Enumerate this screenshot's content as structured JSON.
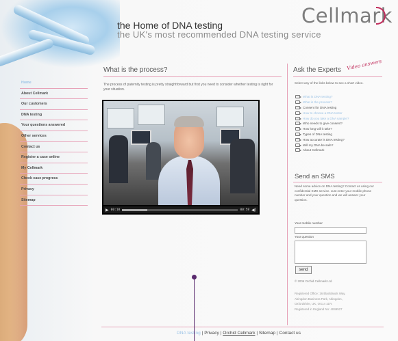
{
  "header": {
    "logo": "Cellmark",
    "title": "the Home of DNA testing",
    "subtitle": "the UK's most recommended DNA testing service"
  },
  "nav": {
    "items": [
      {
        "label": "Home",
        "active": true
      },
      {
        "label": "About Cellmark",
        "active": false
      },
      {
        "label": "Our customers",
        "active": false
      },
      {
        "label": "DNA testing",
        "active": false
      },
      {
        "label": "Your questions answered",
        "active": false
      },
      {
        "label": "Other services",
        "active": false
      },
      {
        "label": "Contact us",
        "active": false
      },
      {
        "label": "Register a case online",
        "active": false
      },
      {
        "label": "My Cellmark",
        "active": false
      },
      {
        "label": "Check case progress",
        "active": false
      },
      {
        "label": "Privacy",
        "active": false
      },
      {
        "label": "Sitemap",
        "active": false
      }
    ]
  },
  "main": {
    "heading": "What is the process?",
    "intro": "The process of paternity testing is pretty straightforward but first you need to consider whether testing is right for your situation.",
    "video": {
      "time_elapsed": "00:10",
      "time_total": "00:58",
      "progress": 0.22
    }
  },
  "experts": {
    "heading": "Ask the Experts",
    "badge": "Video answers",
    "intro": "Select any of the links below to see a short video.",
    "questions": [
      {
        "label": "What is DNA testing?",
        "visited": true
      },
      {
        "label": "What is the process?",
        "visited": true
      },
      {
        "label": "Consent for DNA testing",
        "visited": false
      },
      {
        "label": "How to choose a DNA tester",
        "visited": true
      },
      {
        "label": "How do you take a DNA sample?",
        "visited": true
      },
      {
        "label": "Who needs to give consent?",
        "visited": false
      },
      {
        "label": "How long will it take?",
        "visited": false
      },
      {
        "label": "Types of DNA testing",
        "visited": false
      },
      {
        "label": "How accurate is DNA testing?",
        "visited": false
      },
      {
        "label": "Will my DNA be safe?",
        "visited": false
      },
      {
        "label": "About Cellmark",
        "visited": false
      }
    ]
  },
  "sms": {
    "heading": "Send an SMS",
    "text": "Need some advice on DNA testing? Contact us using our confidential SMS service. Just enter your mobile phone number and your question and we will answer your question.",
    "mobile_label": "Your mobile number",
    "question_label": "Your question",
    "mobile_value": "",
    "question_value": "",
    "send_label": "send"
  },
  "legal": {
    "copyright": "© 2006 Orchid Cellmark Ltd.",
    "registered_lines": [
      "Registered Office: 16 Blacklands Way,",
      "Abingdon Business Park, Abingdon,",
      "Oxfordshire, UK, OX14 1DY.",
      "Registered in England No: 4049527"
    ]
  },
  "footer": {
    "link1": "DNA testing",
    "sep": " | ",
    "link2": "Privacy",
    "link3": "Orchid Cellmark",
    "link4": "Sitemap",
    "link5": "Contact us"
  },
  "colors": {
    "accent_pink": "#e7a2b8",
    "brand_magenta": "#c12d5c",
    "visited_blue": "#9cc3e6",
    "callout_purple": "#5a2a6e"
  },
  "icons": {
    "video_icon": "video-clip-icon",
    "play": "play-icon",
    "volume": "volume-icon"
  }
}
